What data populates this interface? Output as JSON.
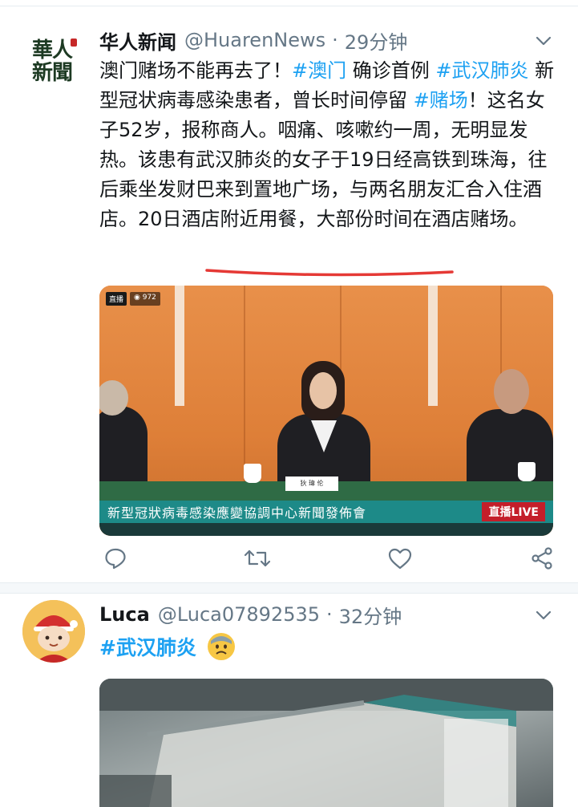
{
  "tweet1": {
    "avatar_text_line1": "華人",
    "avatar_text_line2": "新聞",
    "name": "华人新闻",
    "handle": "@HuarenNews",
    "separator": "·",
    "time": "29分钟",
    "text_parts": [
      {
        "t": "澳门赌场不能再去了！",
        "tag": false
      },
      {
        "t": "#澳门",
        "tag": true
      },
      {
        "t": " 确诊首例 ",
        "tag": false
      },
      {
        "t": "#武汉肺炎",
        "tag": true
      },
      {
        "t": " 新型冠状病毒感染患者，曾长时间停留 ",
        "tag": false
      },
      {
        "t": "#赌场",
        "tag": true
      },
      {
        "t": "！这名女子52岁，报称商人。咽痛、咳嗽约一周，无明显发热。该患有武汉肺炎的女子于19日经高铁到珠海，往后乘坐发财巴来到置地广场，与两名朋友汇合入住酒店。20日酒店附近用餐，大部份时间在酒店赌场。",
        "tag": false
      }
    ],
    "media": {
      "live_badge": "直播",
      "view_count": "972",
      "caption": "新型冠狀病毒感染應變協調中心新聞發佈會",
      "live_tag": "直播LIVE",
      "nameplate": "狄 瑋 伦"
    }
  },
  "tweet2": {
    "name": "Luca",
    "handle": "@Luca07892535",
    "separator": "·",
    "time": "32分钟",
    "hashtag": "#武汉肺炎"
  },
  "colors": {
    "link": "#1da1f2",
    "text": "#14171a",
    "muted": "#657786",
    "underline_mark": "#e53935"
  },
  "icons": [
    "reply-icon",
    "retweet-icon",
    "like-icon",
    "share-icon",
    "chevron-down-icon"
  ]
}
